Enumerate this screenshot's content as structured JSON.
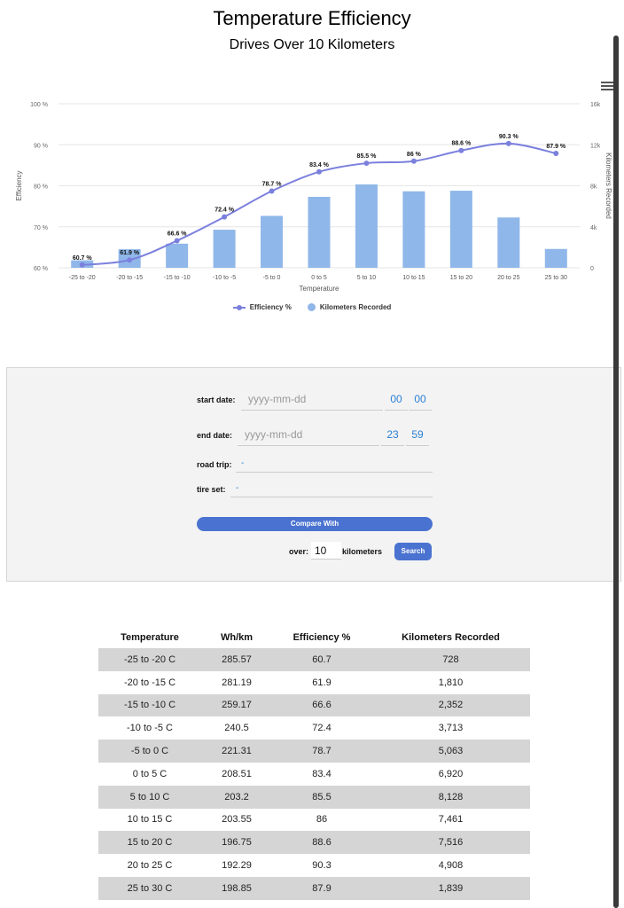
{
  "header": {
    "title": "Temperature Efficiency",
    "subtitle": "Drives Over 10 Kilometers"
  },
  "chart_data": {
    "type": "bar",
    "categories": [
      "-25 to -20",
      "-20 to -15",
      "-15 to -10",
      "-10 to -5",
      "-5 to 0",
      "0 to 5",
      "5 to 10",
      "10 to 15",
      "15 to 20",
      "20 to 25",
      "25 to 30"
    ],
    "series": [
      {
        "name": "Efficiency %",
        "type": "line",
        "axis": "left",
        "color": "#7b80dd",
        "values": [
          60.7,
          61.9,
          66.6,
          72.4,
          78.7,
          83.4,
          85.5,
          86,
          88.6,
          90.3,
          87.9
        ],
        "labels": [
          "60.7 %",
          "61.9 %",
          "66.6 %",
          "72.4 %",
          "78.7 %",
          "83.4 %",
          "85.5 %",
          "86 %",
          "88.6 %",
          "90.3 %",
          "87.9 %"
        ]
      },
      {
        "name": "Kilometers Recorded",
        "type": "bar",
        "axis": "right",
        "color": "#8fb7e9",
        "values": [
          728,
          1810,
          2352,
          3713,
          5063,
          6920,
          8128,
          7461,
          7516,
          4908,
          1839
        ]
      }
    ],
    "xlabel": "Temperature",
    "ylabel": "Efficiency",
    "y2label": "Kilometers Recorded",
    "ylim": [
      60,
      100
    ],
    "y2lim": [
      0,
      16000
    ],
    "yticks": [
      "60 %",
      "70 %",
      "80 %",
      "90 %",
      "100 %"
    ],
    "y2ticks": [
      "0",
      "4k",
      "8k",
      "12k",
      "16k"
    ],
    "grid": true,
    "legend_position": "bottom-center"
  },
  "legend": {
    "efficiency": "Efficiency %",
    "kilometers": "Kilometers Recorded"
  },
  "form": {
    "start_date_label": "start date:",
    "start_date_placeholder": "yyyy-mm-dd",
    "start_hour": "00",
    "start_minute": "00",
    "end_date_label": "end date:",
    "end_date_placeholder": "yyyy-mm-dd",
    "end_hour": "23",
    "end_minute": "59",
    "road_trip_label": "road trip:",
    "road_trip_value": "-",
    "tire_set_label": "tire set:",
    "tire_set_value": "-",
    "compare_label": "Compare With",
    "over_label": "over:",
    "over_value": "10",
    "kilometers_label": "kilometers",
    "search_label": "Search"
  },
  "table": {
    "headers": [
      "Temperature",
      "Wh/km",
      "Efficiency %",
      "Kilometers Recorded"
    ],
    "rows": [
      [
        "-25 to -20 C",
        "285.57",
        "60.7",
        "728"
      ],
      [
        "-20 to -15 C",
        "281.19",
        "61.9",
        "1,810"
      ],
      [
        "-15 to -10 C",
        "259.17",
        "66.6",
        "2,352"
      ],
      [
        "-10 to -5 C",
        "240.5",
        "72.4",
        "3,713"
      ],
      [
        "-5 to 0 C",
        "221.31",
        "78.7",
        "5,063"
      ],
      [
        "0 to 5 C",
        "208.51",
        "83.4",
        "6,920"
      ],
      [
        "5 to 10 C",
        "203.2",
        "85.5",
        "8,128"
      ],
      [
        "10 to 15 C",
        "203.55",
        "86",
        "7,461"
      ],
      [
        "15 to 20 C",
        "196.75",
        "88.6",
        "7,516"
      ],
      [
        "20 to 25 C",
        "192.29",
        "90.3",
        "4,908"
      ],
      [
        "25 to 30 C",
        "198.85",
        "87.9",
        "1,839"
      ]
    ]
  }
}
